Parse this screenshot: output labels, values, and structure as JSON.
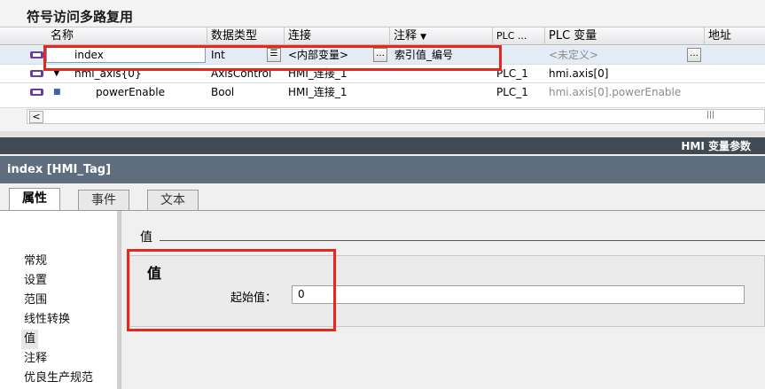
{
  "table": {
    "title": "符号访问多路复用",
    "columns": [
      "名称",
      "数据类型",
      "连接",
      "注释",
      "PLC ...",
      "PLC 变量",
      "地址"
    ],
    "rows": [
      {
        "name": "index",
        "type": "Int",
        "connection": "<内部变量>",
        "comment": "索引值_编号",
        "plc": "",
        "plc_var": "<未定义>",
        "address": ""
      },
      {
        "name": "hmi_axis{0}",
        "type": "AxisControl",
        "connection": "HMI_连接_1",
        "comment": "",
        "plc": "PLC_1",
        "plc_var": "hmi.axis[0]",
        "address": ""
      },
      {
        "name": "powerEnable",
        "type": "Bool",
        "connection": "HMI_连接_1",
        "comment": "",
        "plc": "PLC_1",
        "plc_var": "hmi.axis[0].powerEnable",
        "address": ""
      }
    ]
  },
  "panel_title": "HMI 变量参数",
  "inspector": {
    "title": "index [HMI_Tag]",
    "tabs": [
      "属性",
      "事件",
      "文本"
    ],
    "active_tab": "属性",
    "nav": [
      "常规",
      "设置",
      "范围",
      "线性转换",
      "值",
      "注释",
      "优良生产规范"
    ],
    "selected_nav": "值",
    "section_title": "值",
    "group_title": "值",
    "start_value_label": "起始值：",
    "start_value": "0"
  },
  "icons": {
    "tag": "hmi-tag-icon",
    "expand": "triangle-down-icon",
    "member": "member-bullet-icon",
    "dropdown": "list-icon",
    "browse": "ellipsis-icon"
  },
  "colors": {
    "annotation": "#e8261c",
    "dark_bar": "#3f4a55",
    "inspector_title": "#5f6e7e"
  }
}
